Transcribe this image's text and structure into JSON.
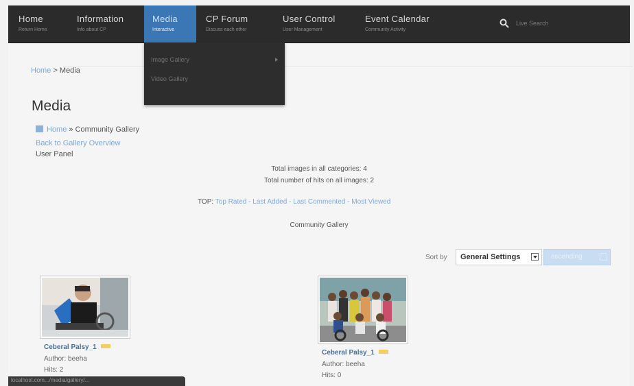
{
  "nav": {
    "items": [
      {
        "title": "Home",
        "subtitle": "Return Home"
      },
      {
        "title": "Information",
        "subtitle": "Info about CP"
      },
      {
        "title": "Media",
        "subtitle": "Interactive"
      },
      {
        "title": "CP Forum",
        "subtitle": "Discuss each other"
      },
      {
        "title": "User Control",
        "subtitle": "User Management"
      },
      {
        "title": "Event Calendar",
        "subtitle": "Community Activity"
      }
    ],
    "search_placeholder": "Live Search",
    "active_index": 2
  },
  "dropdown": {
    "items": [
      "Image Gallery",
      "Video Gallery"
    ]
  },
  "breadcrumb": {
    "home": "Home",
    "separator": ">",
    "current": "Media"
  },
  "page": {
    "title": "Media"
  },
  "gallery": {
    "path_home": "Home",
    "path_sep": "»",
    "path_current": "Community Gallery",
    "back_link": "Back to Gallery Overview",
    "user_panel": "User Panel",
    "total_images": "Total images in all categories: 4",
    "total_hits": "Total number of hits on all images: 2",
    "top_label": "TOP:",
    "top_links": [
      "Top Rated",
      "Last Added",
      "Last Commented",
      "Most Viewed"
    ],
    "top_sep": " - ",
    "category_title": "Community Gallery",
    "sort_label": "Sort by",
    "sort_value": "General Settings",
    "order_value": "ascending",
    "images": [
      {
        "title": "Ceberal Palsy_1",
        "author": "Author: beeha",
        "hits": "Hits: 2"
      },
      {
        "title": "Ceberal Palsy_1",
        "author": "Author: beeha",
        "hits": "Hits: 0"
      }
    ]
  },
  "status_bar": {
    "text": "localhost.com.../media/gallery/..."
  },
  "colors": {
    "nav_bg": "#2b2b2b",
    "nav_active": "#3b76b5",
    "link": "#7fa8d8"
  }
}
